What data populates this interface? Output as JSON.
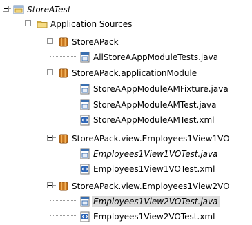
{
  "tree": {
    "root": {
      "label": "StoreATest",
      "icon": "project-icon",
      "expanded": true
    },
    "application_sources": {
      "label": "Application Sources",
      "icon": "folder-icon",
      "expanded": true
    },
    "packages": [
      {
        "label": "StoreAPack",
        "icon": "package-icon",
        "expanded": true,
        "files": [
          {
            "label": "AllStoreAAppModuleTests.java",
            "icon": "java-file-icon",
            "italic": false,
            "selected": false
          }
        ]
      },
      {
        "label": "StoreAPack.applicationModule",
        "icon": "package-icon",
        "expanded": true,
        "files": [
          {
            "label": "StoreAAppModuleAMFixture.java",
            "icon": "java-file-icon",
            "italic": false,
            "selected": false
          },
          {
            "label": "StoreAAppModuleAMTest.java",
            "icon": "java-file-icon",
            "italic": false,
            "selected": false
          },
          {
            "label": "StoreAAppModuleAMTest.xml",
            "icon": "xml-file-icon",
            "italic": false,
            "selected": false
          }
        ]
      },
      {
        "label": "StoreAPack.view.Employees1View1VO",
        "icon": "package-icon",
        "expanded": true,
        "files": [
          {
            "label": "Employees1View1VOTest.java",
            "icon": "java-file-icon",
            "italic": true,
            "selected": false
          },
          {
            "label": "Employees1View1VOTest.xml",
            "icon": "xml-file-icon",
            "italic": false,
            "selected": false
          }
        ]
      },
      {
        "label": "StoreAPack.view.Employees1View2VO",
        "icon": "package-icon",
        "expanded": true,
        "files": [
          {
            "label": "Employees1View2VOTest.java",
            "icon": "java-file-icon",
            "italic": true,
            "selected": true
          },
          {
            "label": "Employees1View2VOTest.xml",
            "icon": "xml-file-icon",
            "italic": false,
            "selected": false
          }
        ]
      }
    ]
  },
  "colors": {
    "folder": "#e8c25a",
    "package": "#c9761e",
    "java_file": "#3a6fb0",
    "xml_file": "#2f67b8",
    "selection": "#dcdcdc"
  }
}
